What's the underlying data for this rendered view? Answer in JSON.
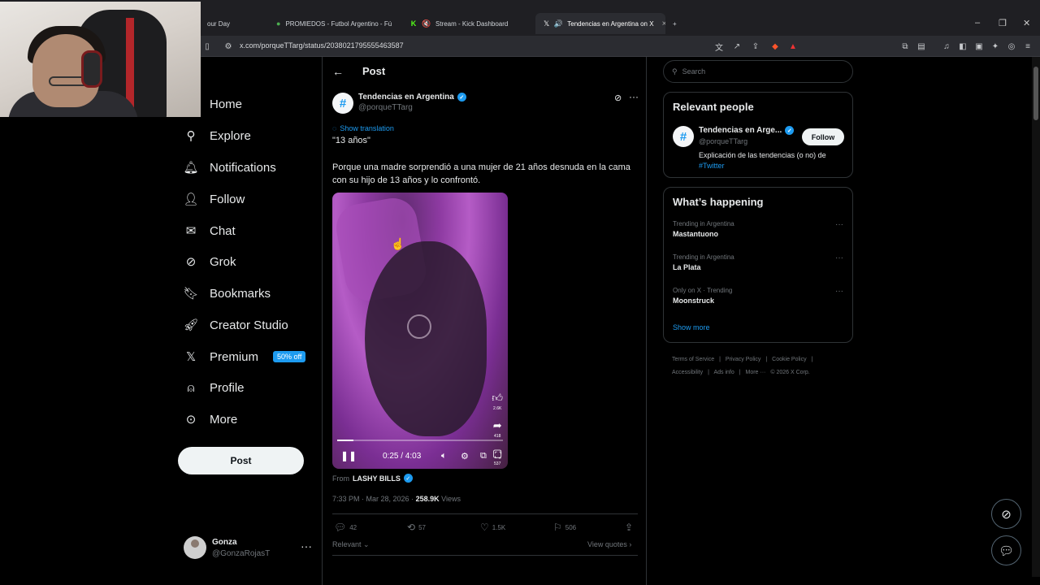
{
  "browser": {
    "tabs": [
      {
        "label": "our Day",
        "icon": "tab-icon"
      },
      {
        "label": "PROMIEDOS - Futbol Argentino - Fú",
        "icon": "promiedos-icon"
      },
      {
        "label": "Stream - Kick Dashboard",
        "icon": "kick-icon"
      },
      {
        "label": "Tendencias en Argentina on X",
        "icon": "x-icon"
      }
    ],
    "new_tab": "+",
    "url": "x.com/porqueTTarg/status/2038021795555463587"
  },
  "nav": {
    "items": [
      {
        "label": "Home",
        "icon": "home-icon"
      },
      {
        "label": "Explore",
        "icon": "search-icon"
      },
      {
        "label": "Notifications",
        "icon": "bell-icon"
      },
      {
        "label": "Follow",
        "icon": "add-user-icon"
      },
      {
        "label": "Chat",
        "icon": "mail-icon"
      },
      {
        "label": "Grok",
        "icon": "grok-icon"
      },
      {
        "label": "Bookmarks",
        "icon": "bookmark-icon"
      },
      {
        "label": "Creator Studio",
        "icon": "rocket-icon"
      },
      {
        "label": "Premium",
        "icon": "x-logo-icon"
      },
      {
        "label": "Profile",
        "icon": "person-icon"
      },
      {
        "label": "More",
        "icon": "more-circle-icon"
      }
    ],
    "premium_badge": "50% off",
    "post_button": "Post"
  },
  "account": {
    "name": "Gonza",
    "handle": "@GonzaRojasT",
    "more": "···"
  },
  "post": {
    "header_title": "Post",
    "author_name": "Tendencias en Argentina",
    "author_handle": "@porqueTTarg",
    "avatar_glyph": "#",
    "show_translation": "Show translation",
    "quote": "\"13 años\"",
    "body": "Porque una madre sorprendió a una mujer de 21 años desnuda en la cama con su hijo de 13 años y lo confrontó.",
    "video": {
      "time": "0:25 / 4:03",
      "progress": 0.1,
      "rail_like_count": "2.6K",
      "rail_share_count": "418",
      "rail_other_count": "537"
    },
    "from_label": "From",
    "from_name": "LASHY BILLS",
    "timestamp": "7:33 PM · Mar 28, 2026 ·",
    "views_count": "258.9K",
    "views_label": "Views",
    "replies": "42",
    "reposts": "57",
    "likes": "1.5K",
    "bookmarks": "506",
    "relevant_label": "Relevant",
    "view_quotes": "View quotes"
  },
  "sidebar": {
    "search_placeholder": "Search",
    "relevant_people_title": "Relevant people",
    "person": {
      "name": "Tendencias en Arge...",
      "handle": "@porqueTTarg",
      "follow": "Follow",
      "bio": "Explicación de las tendencias (o no) de",
      "bio_tag": "#Twitter"
    },
    "happening_title": "What’s happening",
    "trends": [
      {
        "context": "Trending in Argentina",
        "title": "Mastantuono"
      },
      {
        "context": "Trending in Argentina",
        "title": "La Plata"
      },
      {
        "context": "Only on X · Trending",
        "title": "Moonstruck"
      }
    ],
    "show_more": "Show more",
    "footer_links": [
      "Terms of Service",
      "|",
      "Privacy Policy",
      "|",
      "Cookie Policy",
      "|",
      "Accessibility",
      "|",
      "Ads info",
      "|",
      "More ···",
      "© 2026 X Corp."
    ]
  },
  "colors": {
    "accent": "#1d9bf0",
    "background": "#000000",
    "text": "#e7e9ea",
    "muted": "#71767b"
  }
}
